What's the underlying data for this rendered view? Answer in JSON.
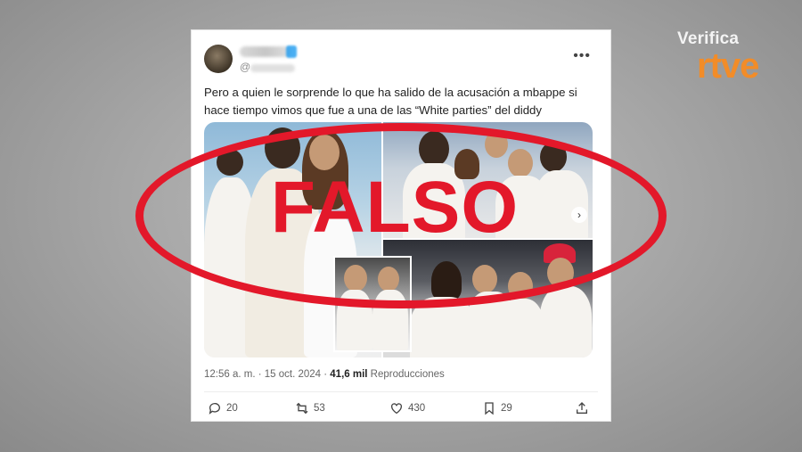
{
  "brand": {
    "top": "Verifica",
    "logo": "rtve",
    "accent": "#f28c28"
  },
  "tweet": {
    "handle_prefix": "@",
    "text": "Pero a quien le sorprende lo que ha salido de la acusación a mbappe si hace tiempo vimos que fue a una de las “White parties” del diddy",
    "timestamp": "12:56 a. m. · 15 oct. 2024 · ",
    "views_count": "41,6 mil",
    "views_label": " Reproducciones",
    "replies": "20",
    "retweets": "53",
    "likes": "430",
    "bookmarks": "29"
  },
  "stamp": {
    "label": "FALSO",
    "color": "#e3182a"
  },
  "icons": [
    "more-icon",
    "next-arrow-icon",
    "reply-icon",
    "retweet-icon",
    "like-icon",
    "bookmark-icon",
    "share-icon"
  ]
}
